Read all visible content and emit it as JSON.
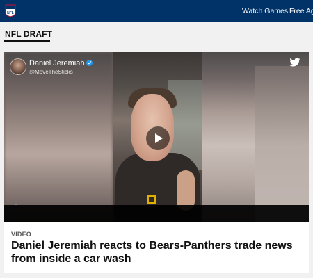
{
  "header": {
    "logo_name": "NFL",
    "nav": [
      "Watch Games",
      "Free Age"
    ]
  },
  "section": {
    "title": "NFL DRAFT"
  },
  "video_card": {
    "author_name": "Daniel Jeremiah",
    "author_handle": "@MoveTheSticks",
    "category": "VIDEO",
    "headline": "Daniel Jeremiah reacts to Bears-Panthers trade news from inside a car wash",
    "icons": [
      "play-icon",
      "twitter-icon",
      "verified-icon"
    ]
  },
  "colors": {
    "header_bg": "#013369",
    "page_bg": "#f1f1f1",
    "card_bg": "#ffffff",
    "twitter_blue": "#1d9bf0"
  }
}
